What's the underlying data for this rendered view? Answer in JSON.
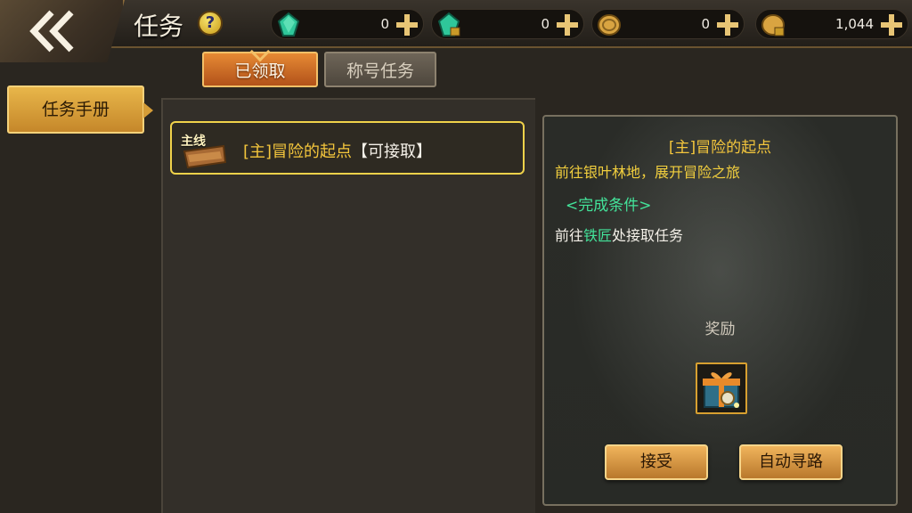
{
  "header": {
    "title": "任务",
    "help_symbol": "?"
  },
  "currencies": [
    {
      "icon": "green-gem-icon",
      "value": "0"
    },
    {
      "icon": "locked-green-gem-icon",
      "value": "0"
    },
    {
      "icon": "gold-coin-icon",
      "value": "0"
    },
    {
      "icon": "locked-gold-coin-icon",
      "value": "1,044"
    }
  ],
  "tabs": [
    {
      "label": "已领取",
      "active": true
    },
    {
      "label": "称号任务",
      "active": false
    }
  ],
  "sidebar": {
    "items": [
      {
        "label": "任务手册"
      }
    ]
  },
  "quest_list": [
    {
      "badge": "主线",
      "title": "[主]冒险的起点",
      "status": "【可接取】"
    }
  ],
  "detail": {
    "title": "[主]冒险的起点",
    "description": "前往银叶林地，展开冒险之旅",
    "condition_header": "<完成条件>",
    "condition_prefix": "前往",
    "condition_npc": "铁匠",
    "condition_suffix": "处接取任务",
    "reward_label": "奖励",
    "reward_icon": "gift-box-icon",
    "accept_label": "接受",
    "auto_path_label": "自动寻路"
  },
  "colors": {
    "accent_gold": "#f4c63c",
    "condition_green": "#43e39a",
    "active_tab": "#e68a34"
  }
}
